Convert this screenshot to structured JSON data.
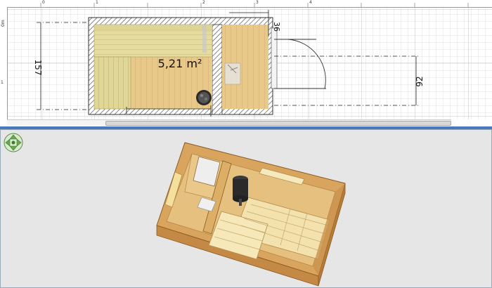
{
  "plan": {
    "area_label": "5,21 m²",
    "dim_height": "157",
    "dim_right": "92",
    "dim_small": "36",
    "ruler_top_labels": [
      "0",
      "1",
      "2",
      "3",
      "4"
    ],
    "ruler_left_labels": [
      "0m",
      "1"
    ]
  },
  "colors": {
    "wood_light": "#e8c98a",
    "wood_bench": "#e6dca0",
    "wall_hatch": "#555555",
    "accent_blue": "#4a78b8",
    "nav_green": "#6aa84f"
  },
  "icons": {
    "navigation": "four-arrow-compass-icon",
    "stove": "sauna-stove-icon"
  }
}
